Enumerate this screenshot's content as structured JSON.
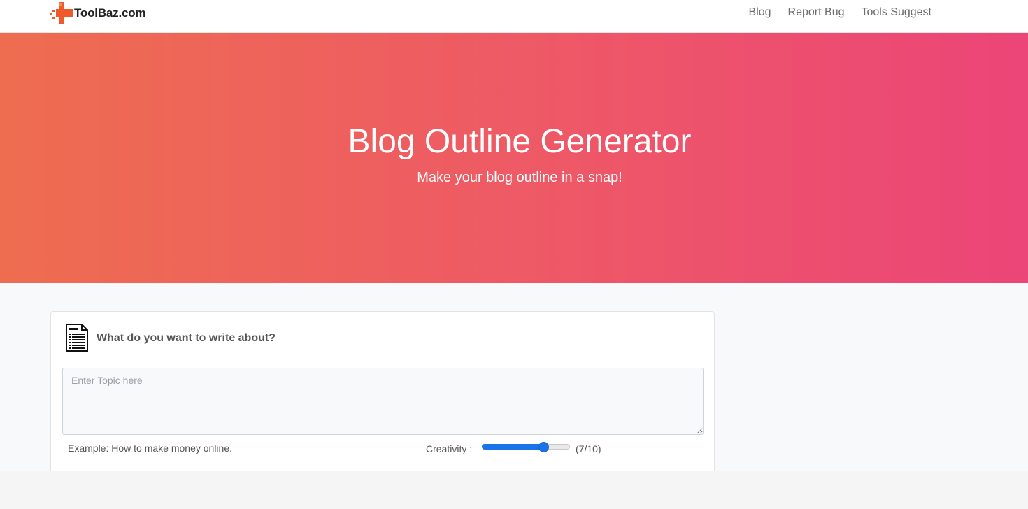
{
  "brand": {
    "name": "ToolBaz.com",
    "icon": "toolbaz-logo-icon",
    "accent": "#ee5a2a"
  },
  "nav": {
    "items": [
      {
        "label": "Blog"
      },
      {
        "label": "Report Bug"
      },
      {
        "label": "Tools Suggest"
      }
    ]
  },
  "hero": {
    "title": "Blog Outline Generator",
    "subtitle": "Make your blog outline in a snap!",
    "gradient_start": "#ee6d50",
    "gradient_end": "#ec4578"
  },
  "form": {
    "heading": "What do you want to write about?",
    "heading_icon": "document-icon",
    "topic_placeholder": "Enter Topic here",
    "topic_value": "",
    "example_text": "Example: How to make money online.",
    "creativity_label": "Creativity :",
    "creativity_value": 7,
    "creativity_max": 10,
    "creativity_display": "(7/10)",
    "slider_color": "#1a73e8"
  }
}
